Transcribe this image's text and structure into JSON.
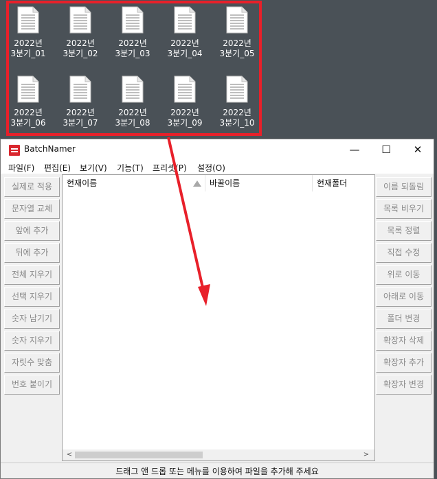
{
  "desktop": {
    "files": [
      {
        "line1": "2022년",
        "line2": "3분기_01"
      },
      {
        "line1": "2022년",
        "line2": "3분기_02"
      },
      {
        "line1": "2022년",
        "line2": "3분기_03"
      },
      {
        "line1": "2022년",
        "line2": "3분기_04"
      },
      {
        "line1": "2022년",
        "line2": "3분기_05"
      },
      {
        "line1": "2022년",
        "line2": "3분기_06"
      },
      {
        "line1": "2022년",
        "line2": "3분기_07"
      },
      {
        "line1": "2022년",
        "line2": "3분기_08"
      },
      {
        "line1": "2022년",
        "line2": "3분기_09"
      },
      {
        "line1": "2022년",
        "line2": "3분기_10"
      }
    ],
    "selection_color": "#e8202a"
  },
  "window": {
    "title": "BatchNamer",
    "controls": {
      "minimize": "—",
      "maximize": "☐",
      "close": "✕"
    }
  },
  "menu": [
    "파일(F)",
    "편집(E)",
    "보기(V)",
    "기능(T)",
    "프리셋(P)",
    "설정(O)"
  ],
  "left_buttons": [
    "실제로 적용",
    "문자열 교체",
    "앞에 추가",
    "뒤에 추가",
    "전체 지우기",
    "선택 지우기",
    "숫자 남기기",
    "숫자 지우기",
    "자릿수 맞춤",
    "번호 붙이기"
  ],
  "right_buttons": [
    "이름 되돌림",
    "목록 비우기",
    "목록 정렬",
    "직접 수정",
    "위로 이동",
    "아래로 이동",
    "폴더 변경",
    "확장자 삭제",
    "확장자 추가",
    "확장자 변경"
  ],
  "list": {
    "columns": [
      "현재이름",
      "바꿀이름",
      "현재폴더"
    ],
    "sort_indicator": "ascending",
    "scroll": {
      "left": "<",
      "right": ">"
    }
  },
  "status": "드래그 앤 드롭 또는 메뉴를 이용하여 파일을 추가해 주세요"
}
